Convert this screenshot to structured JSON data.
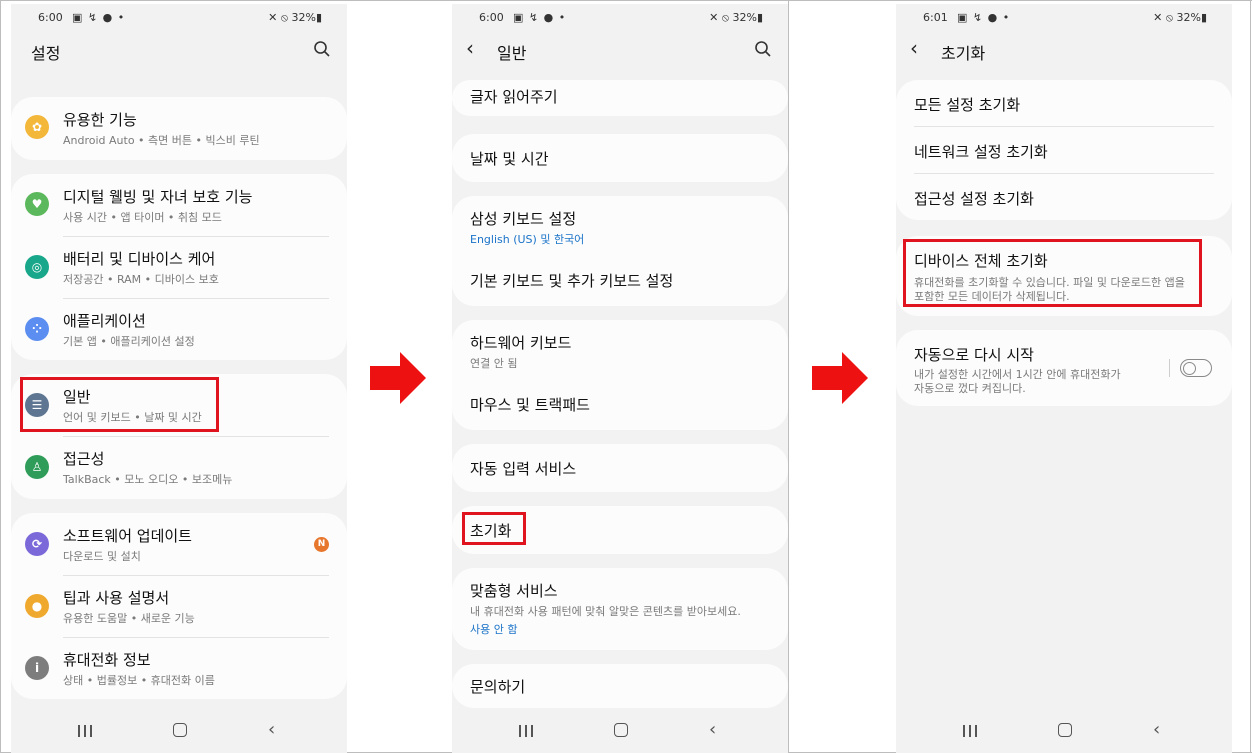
{
  "status": [
    {
      "time": "6:00",
      "notif_icons": "▣ ↯ ● •",
      "battery": "✕ ⦸ 32%▮"
    },
    {
      "time": "6:00",
      "notif_icons": "▣ ↯ ● •",
      "battery": "✕ ⦸ 32%▮"
    },
    {
      "time": "6:01",
      "notif_icons": "▣ ↯ ● •",
      "battery": "✕ ⦸ 32%▮"
    }
  ],
  "screen1": {
    "title": "설정",
    "items": [
      {
        "title": "유용한 기능",
        "sub": "Android Auto  •  측면 버튼  •  빅스비 루틴",
        "icon": "gear-plus-icon",
        "color": "#f3b73a"
      },
      {
        "title": "디지털 웰빙 및 자녀 보호 기능",
        "sub": "사용 시간  •  앱 타이머  •  취침 모드",
        "icon": "wellbeing-icon",
        "color": "#5cb85c"
      },
      {
        "title": "배터리 및 디바이스 케어",
        "sub": "저장공간  •  RAM  •  디바이스 보호",
        "icon": "device-care-icon",
        "color": "#18a78a"
      },
      {
        "title": "애플리케이션",
        "sub": "기본 앱  •  애플리케이션 설정",
        "icon": "apps-icon",
        "color": "#5b8ef0"
      },
      {
        "title": "일반",
        "sub": "언어 및 키보드  •  날짜 및 시간",
        "icon": "sliders-icon",
        "color": "#5e7691"
      },
      {
        "title": "접근성",
        "sub": "TalkBack  •  모노 오디오  •  보조메뉴",
        "icon": "accessibility-icon",
        "color": "#2f9d59"
      },
      {
        "title": "소프트웨어 업데이트",
        "sub": "다운로드 및 설치",
        "icon": "update-icon",
        "color": "#7b68d9",
        "badge": "N"
      },
      {
        "title": "팁과 사용 설명서",
        "sub": "유용한 도움말  •  새로운 기능",
        "icon": "bulb-icon",
        "color": "#f0a92f"
      },
      {
        "title": "휴대전화 정보",
        "sub": "상태  •  법률정보  •  휴대전화 이름",
        "icon": "info-icon",
        "color": "#7d7d7d"
      }
    ]
  },
  "screen2": {
    "title": "일반",
    "items": [
      {
        "title": "글자 읽어주기"
      },
      {
        "title": "날짜 및 시간"
      },
      {
        "title": "삼성 키보드 설정",
        "sub": "English (US) 및 한국어"
      },
      {
        "title": "기본 키보드 및 추가 키보드 설정"
      },
      {
        "title": "하드웨어 키보드",
        "sub": "연결 안 됨"
      },
      {
        "title": "마우스 및 트랙패드"
      },
      {
        "title": "자동 입력 서비스"
      },
      {
        "title": "초기화"
      },
      {
        "title": "맞춤형 서비스",
        "sub": "내 휴대전화 사용 패턴에 맞춰 알맞은 콘텐츠를 받아보세요.",
        "sub2": "사용 안 함"
      },
      {
        "title": "문의하기"
      }
    ]
  },
  "screen3": {
    "title": "초기화",
    "items": [
      {
        "title": "모든 설정 초기화"
      },
      {
        "title": "네트워크 설정 초기화"
      },
      {
        "title": "접근성 설정 초기화"
      },
      {
        "title": "디바이스 전체 초기화",
        "sub": "휴대전화를 초기화할 수 있습니다. 파일 및 다운로드한 앱을",
        "sub_line2": "포함한 모든 데이터가 삭제됩니다."
      },
      {
        "title": "자동으로 다시 시작",
        "sub": "내가 설정한 시간에서 1시간 안에 휴대전화가",
        "sub_line2": "자동으로 껐다 켜집니다.",
        "toggle": false
      }
    ]
  },
  "colors": {
    "highlight": "#e0141e",
    "arrow": "#ee1111",
    "link": "#1a73c8"
  }
}
